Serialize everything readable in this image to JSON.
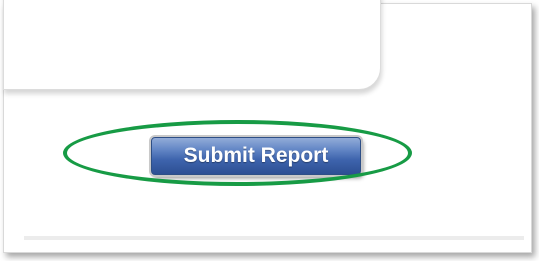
{
  "form": {
    "submit_label": "Submit Report"
  },
  "annotation": {
    "highlight_color": "#179b45"
  },
  "theme": {
    "button_color": "#3e64ad"
  }
}
